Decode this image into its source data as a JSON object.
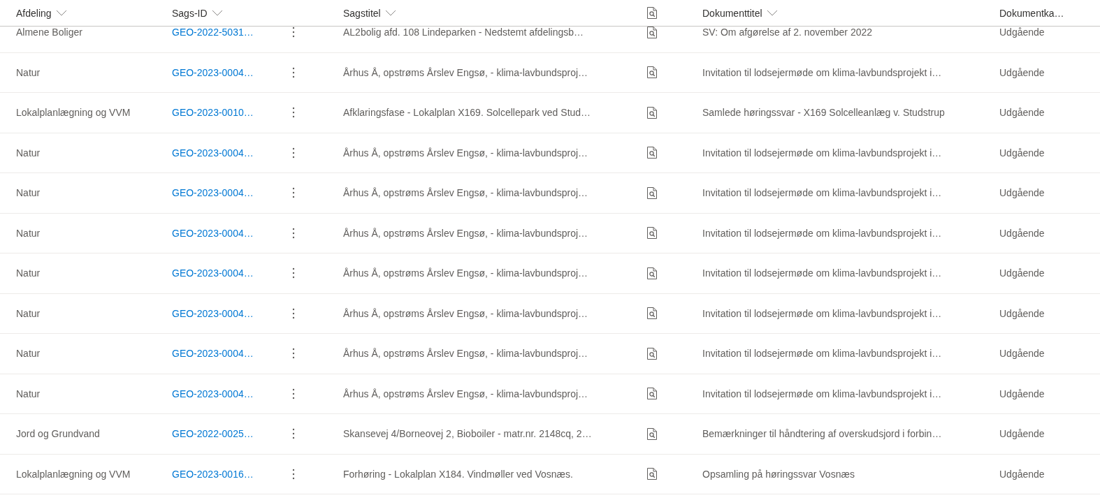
{
  "columns": [
    {
      "kind": "text",
      "label": "Afdeling"
    },
    {
      "kind": "text",
      "label": "Sags-ID"
    },
    {
      "kind": "blank"
    },
    {
      "kind": "text",
      "label": "Sagstitel"
    },
    {
      "kind": "icon"
    },
    {
      "kind": "text",
      "label": "Dokumenttitel"
    },
    {
      "kind": "text",
      "label": "Dokumentka…"
    }
  ],
  "rows": [
    {
      "afdeling": "Almene Boliger",
      "sags_id": "GEO-2022-5031…",
      "sagstitel": "AL2bolig afd. 108 Lindeparken - Nedstemt afdelingsb…",
      "dokumenttitel": "SV: Om afgørelse af 2. november 2022",
      "dokumentkategori": "Udgående"
    },
    {
      "afdeling": "Natur",
      "sags_id": "GEO-2023-0004…",
      "sagstitel": "Århus Å, opstrøms Årslev Engsø, - klima-lavbundsproj…",
      "dokumenttitel": "Invitation til lodsejermøde om klima-lavbundsprojekt i…",
      "dokumentkategori": "Udgående"
    },
    {
      "afdeling": "Lokalplanlægning og VVM",
      "sags_id": "GEO-2023-0010…",
      "sagstitel": "Afklaringsfase - Lokalplan X169. Solcellepark ved Stud…",
      "dokumenttitel": "Samlede høringssvar - X169 Solcelleanlæg v. Studstrup",
      "dokumentkategori": "Udgående"
    },
    {
      "afdeling": "Natur",
      "sags_id": "GEO-2023-0004…",
      "sagstitel": "Århus Å, opstrøms Årslev Engsø, - klima-lavbundsproj…",
      "dokumenttitel": "Invitation til lodsejermøde om klima-lavbundsprojekt i…",
      "dokumentkategori": "Udgående"
    },
    {
      "afdeling": "Natur",
      "sags_id": "GEO-2023-0004…",
      "sagstitel": "Århus Å, opstrøms Årslev Engsø, - klima-lavbundsproj…",
      "dokumenttitel": "Invitation til lodsejermøde om klima-lavbundsprojekt i…",
      "dokumentkategori": "Udgående"
    },
    {
      "afdeling": "Natur",
      "sags_id": "GEO-2023-0004…",
      "sagstitel": "Århus Å, opstrøms Årslev Engsø, - klima-lavbundsproj…",
      "dokumenttitel": "Invitation til lodsejermøde om klima-lavbundsprojekt i…",
      "dokumentkategori": "Udgående"
    },
    {
      "afdeling": "Natur",
      "sags_id": "GEO-2023-0004…",
      "sagstitel": "Århus Å, opstrøms Årslev Engsø, - klima-lavbundsproj…",
      "dokumenttitel": "Invitation til lodsejermøde om klima-lavbundsprojekt i…",
      "dokumentkategori": "Udgående"
    },
    {
      "afdeling": "Natur",
      "sags_id": "GEO-2023-0004…",
      "sagstitel": "Århus Å, opstrøms Årslev Engsø, - klima-lavbundsproj…",
      "dokumenttitel": "Invitation til lodsejermøde om klima-lavbundsprojekt i…",
      "dokumentkategori": "Udgående"
    },
    {
      "afdeling": "Natur",
      "sags_id": "GEO-2023-0004…",
      "sagstitel": "Århus Å, opstrøms Årslev Engsø, - klima-lavbundsproj…",
      "dokumenttitel": "Invitation til lodsejermøde om klima-lavbundsprojekt i…",
      "dokumentkategori": "Udgående"
    },
    {
      "afdeling": "Natur",
      "sags_id": "GEO-2023-0004…",
      "sagstitel": "Århus Å, opstrøms Årslev Engsø, - klima-lavbundsproj…",
      "dokumenttitel": "Invitation til lodsejermøde om klima-lavbundsprojekt i…",
      "dokumentkategori": "Udgående"
    },
    {
      "afdeling": "Jord og Grundvand",
      "sags_id": "GEO-2022-0025…",
      "sagstitel": "Skansevej 4/Borneovej 2, Bioboiler - matr.nr. 2148cq, 2…",
      "dokumenttitel": "Bemærkninger til håndtering af overskudsjord i forbin…",
      "dokumentkategori": "Udgående"
    },
    {
      "afdeling": "Lokalplanlægning og VVM",
      "sags_id": "GEO-2023-0016…",
      "sagstitel": "Forhøring - Lokalplan X184. Vindmøller ved Vosnæs.",
      "dokumenttitel": "Opsamling på høringssvar Vosnæs",
      "dokumentkategori": "Udgående"
    }
  ]
}
